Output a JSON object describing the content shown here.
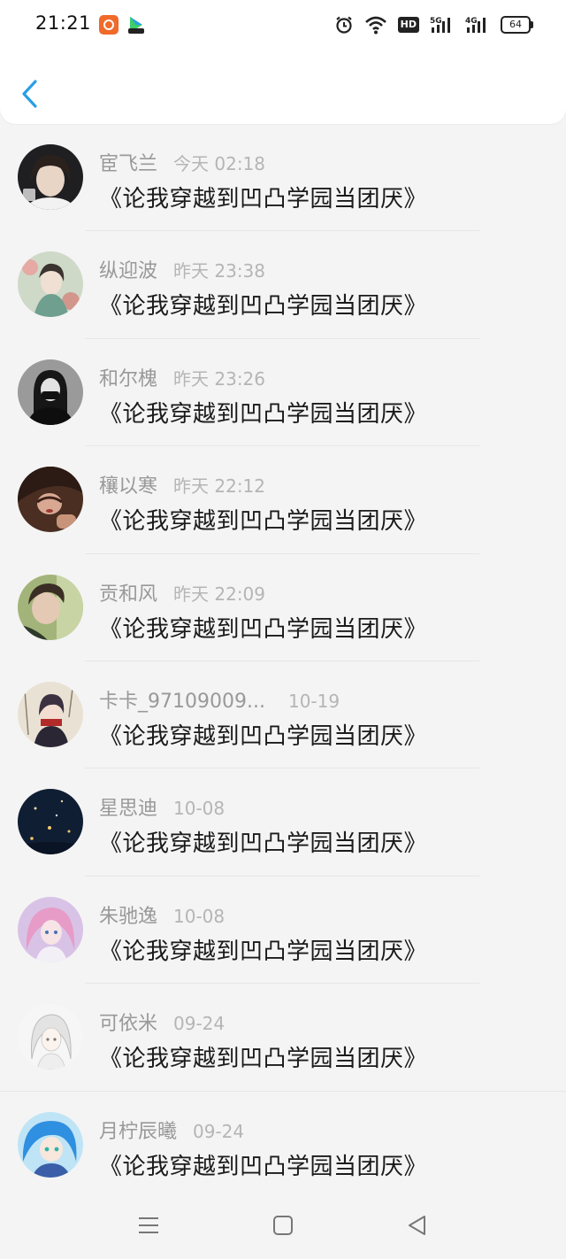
{
  "status_bar": {
    "time": "21:21",
    "icons": [
      "app-icon-orange",
      "video-app-icon",
      "alarm-icon",
      "wifi-icon",
      "hd-icon",
      "5g-signal-icon",
      "4g-signal-icon",
      "battery-icon"
    ],
    "hd_label": "HD",
    "battery": "64"
  },
  "header": {
    "back_icon": "chevron-left-icon",
    "accent": "#2a9ee6"
  },
  "messages": [
    {
      "name": "宦飞兰",
      "time": "今天 02:18",
      "text": "《论我穿越到凹凸学园当团厌》"
    },
    {
      "name": "纵迎波",
      "time": "昨天 23:38",
      "text": "《论我穿越到凹凸学园当团厌》"
    },
    {
      "name": "和尔槐",
      "time": "昨天 23:26",
      "text": "《论我穿越到凹凸学园当团厌》"
    },
    {
      "name": "穰以寒",
      "time": "昨天 22:12",
      "text": "《论我穿越到凹凸学园当团厌》"
    },
    {
      "name": "贡和风",
      "time": "昨天 22:09",
      "text": "《论我穿越到凹凸学园当团厌》"
    },
    {
      "name": "卡卡_97109009...",
      "time": "10-19",
      "text": "《论我穿越到凹凸学园当团厌》"
    },
    {
      "name": "星思迪",
      "time": "10-08",
      "text": "《论我穿越到凹凸学园当团厌》"
    },
    {
      "name": "朱驰逸",
      "time": "10-08",
      "text": "《论我穿越到凹凸学园当团厌》"
    },
    {
      "name": "可依米",
      "time": "09-24",
      "text": "《论我穿越到凹凸学园当团厌》"
    },
    {
      "name": "月柠辰曦",
      "time": "09-24",
      "text": "《论我穿越到凹凸学园当团厌》"
    }
  ],
  "nav_bar": {
    "icons": [
      "menu-icon",
      "home-icon",
      "back-triangle-icon"
    ]
  }
}
